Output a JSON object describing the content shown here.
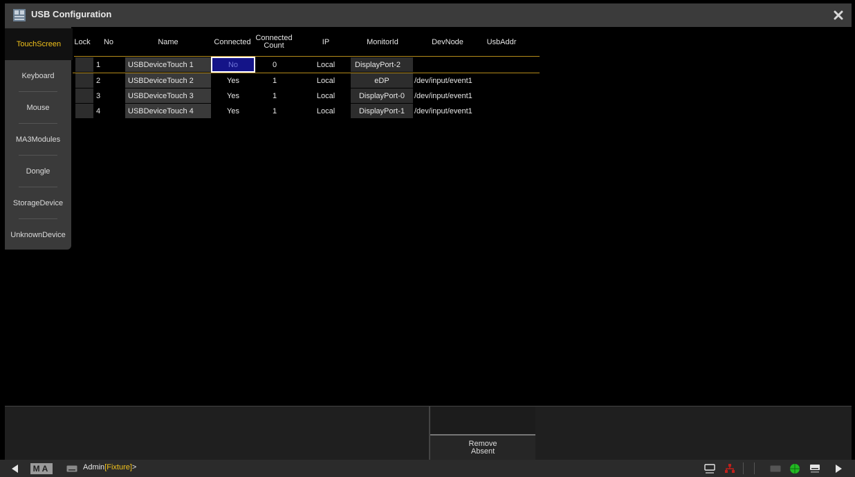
{
  "window": {
    "title": "USB Configuration"
  },
  "sidebar": {
    "tabs": [
      {
        "label": "TouchScreen",
        "active": true
      },
      {
        "label": "Keyboard"
      },
      {
        "label": "Mouse"
      },
      {
        "label": "MA3Modules"
      },
      {
        "label": "Dongle"
      },
      {
        "label": "StorageDevice"
      },
      {
        "label": "UnknownDevice"
      }
    ]
  },
  "table": {
    "headers": {
      "lock": "Lock",
      "no": "No",
      "name": "Name",
      "connected": "Connected",
      "connected_count_1": "Connected",
      "connected_count_2": "Count",
      "ip": "IP",
      "monitor": "MonitorId",
      "devnode": "DevNode",
      "usbaddr": "UsbAddr"
    },
    "rows": [
      {
        "no": "1",
        "name": "USBDeviceTouch 1",
        "connected": "No",
        "count": "0",
        "ip": "Local",
        "monitor": "DisplayPort-2",
        "devnode": "",
        "usbaddr": ""
      },
      {
        "no": "2",
        "name": "USBDeviceTouch 2",
        "connected": "Yes",
        "count": "1",
        "ip": "Local",
        "monitor": "eDP",
        "devnode": "/dev/input/event1",
        "usbaddr": ""
      },
      {
        "no": "3",
        "name": "USBDeviceTouch 3",
        "connected": "Yes",
        "count": "1",
        "ip": "Local",
        "monitor": "DisplayPort-0",
        "devnode": "/dev/input/event1",
        "usbaddr": ""
      },
      {
        "no": "4",
        "name": "USBDeviceTouch 4",
        "connected": "Yes",
        "count": "1",
        "ip": "Local",
        "monitor": "DisplayPort-1",
        "devnode": "/dev/input/event1",
        "usbaddr": ""
      }
    ]
  },
  "bottom": {
    "remove_line1": "Remove",
    "remove_line2": "Absent"
  },
  "statusbar": {
    "ma_logo": "MA",
    "user": "Admin",
    "context": "[Fixture]",
    "prompt": ">",
    "icons": [
      "left-arrow-icon",
      "keyboard-icon",
      "monitor-icon",
      "network-icon",
      "keyboard-icon",
      "globe-icon",
      "keyboard-icon",
      "right-arrow-icon"
    ]
  },
  "colors": {
    "accent": "#f2c21b",
    "header_line": "#b58b1a",
    "selected_cell": "#141488",
    "network_red": "#c0201b",
    "globe_green": "#22b822"
  }
}
